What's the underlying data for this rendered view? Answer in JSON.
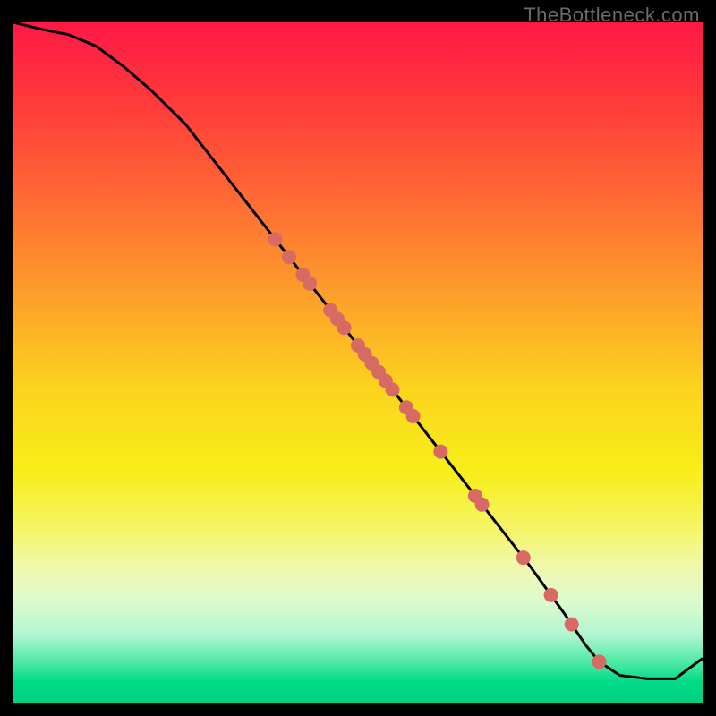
{
  "watermark": "TheBottleneck.com",
  "chart_data": {
    "type": "line",
    "title": "",
    "xlabel": "",
    "ylabel": "",
    "xlim": [
      0,
      100
    ],
    "ylim": [
      0,
      100
    ],
    "series": [
      {
        "name": "curve",
        "x": [
          0,
          4,
          8,
          12,
          16,
          20,
          25,
          30,
          35,
          40,
          45,
          50,
          55,
          60,
          65,
          70,
          75,
          80,
          83,
          85,
          88,
          92,
          96,
          100
        ],
        "y": [
          100,
          99,
          98.2,
          96.5,
          93.5,
          90,
          85,
          78.5,
          72,
          65.5,
          59,
          52.5,
          46,
          39.5,
          33,
          26.5,
          20,
          13,
          8.5,
          6,
          4,
          3.5,
          3.5,
          6.5
        ]
      }
    ],
    "points": {
      "name": "markers",
      "xs": [
        38,
        40,
        42,
        43,
        46,
        47,
        48,
        50,
        51,
        52,
        53,
        54,
        55,
        57,
        58,
        62,
        67,
        68,
        74,
        78,
        81,
        85
      ],
      "radius": 8
    },
    "gradient_stops": [
      {
        "pct": 0,
        "color": "#ff1845"
      },
      {
        "pct": 12,
        "color": "#ff3b3b"
      },
      {
        "pct": 26,
        "color": "#ff6a34"
      },
      {
        "pct": 40,
        "color": "#fc9f2b"
      },
      {
        "pct": 54,
        "color": "#fbd41d"
      },
      {
        "pct": 66,
        "color": "#f7ee19"
      },
      {
        "pct": 74,
        "color": "#f6f562"
      },
      {
        "pct": 80,
        "color": "#f1f8ac"
      },
      {
        "pct": 85,
        "color": "#deface"
      },
      {
        "pct": 90,
        "color": "#b2f6d2"
      },
      {
        "pct": 94,
        "color": "#4fe9a6"
      },
      {
        "pct": 97,
        "color": "#00da88"
      },
      {
        "pct": 100,
        "color": "#00d084"
      }
    ]
  }
}
